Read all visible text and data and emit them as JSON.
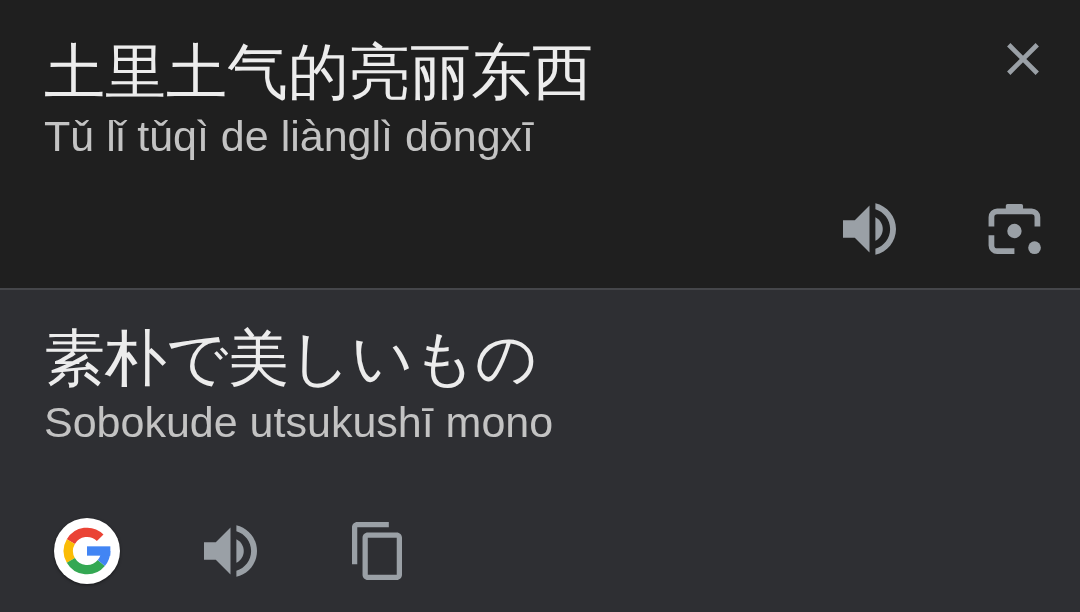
{
  "source": {
    "text": "土里土气的亮丽东西",
    "romanization": "Tǔ lǐ tǔqì de liànglì dōngxī"
  },
  "translation": {
    "text": "素朴で美しいもの",
    "romanization": "Sobokude utsukushī mono"
  }
}
